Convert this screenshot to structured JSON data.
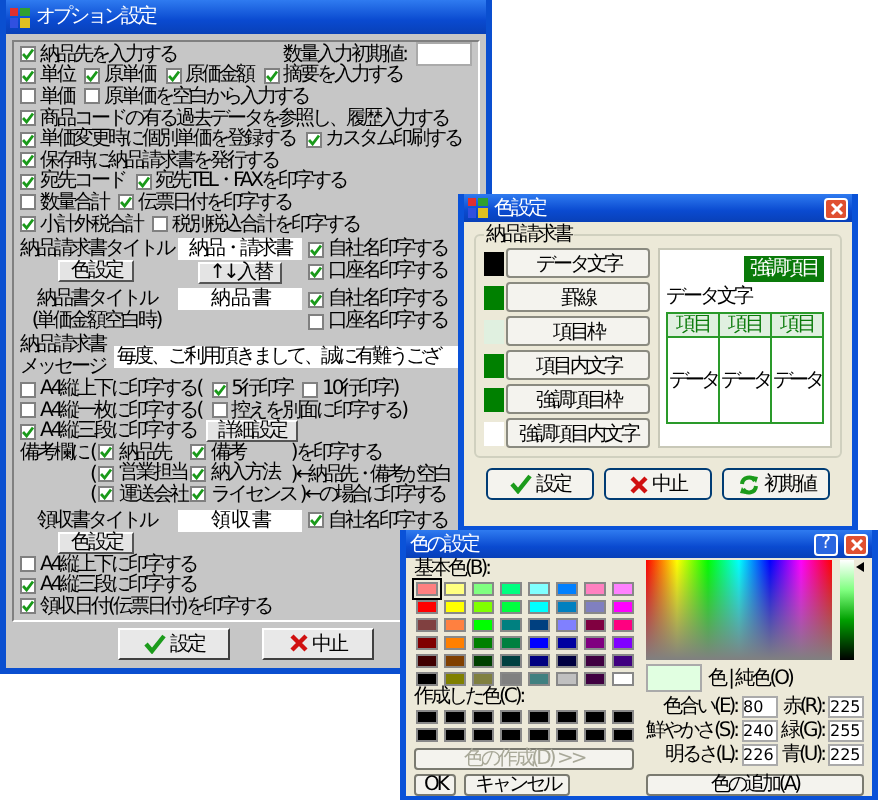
{
  "main_dialog": {
    "title": "オプション設定",
    "rows": [
      {
        "kind": "line",
        "items": [
          {
            "kind": "checkbox",
            "label": "納品先を入力する",
            "checked": true
          },
          {
            "kind": "text",
            "text": "数量入力初期値:"
          },
          {
            "kind": "field"
          }
        ]
      },
      {
        "kind": "line",
        "items": [
          {
            "kind": "checkbox",
            "label": "単位",
            "checked": true
          },
          {
            "kind": "checkbox",
            "label": "原単価",
            "checked": true
          },
          {
            "kind": "checkbox",
            "label": "原価金額",
            "checked": true
          },
          {
            "kind": "checkbox",
            "label": "摘要を入力する",
            "checked": true
          }
        ]
      },
      {
        "kind": "line",
        "items": [
          {
            "kind": "checkbox",
            "label": "単価",
            "checked": false
          },
          {
            "kind": "checkbox",
            "label": "原単価を空白から入力する",
            "checked": false
          }
        ]
      },
      {
        "kind": "line",
        "items": [
          {
            "kind": "checkbox",
            "label": "商品コードの有る過去データを参照し、履歴入力する",
            "checked": true
          }
        ]
      },
      {
        "kind": "line",
        "items": [
          {
            "kind": "checkbox",
            "label": "単価変更時に個別単価を登録する",
            "checked": true
          },
          {
            "kind": "checkbox",
            "label": "カスタム印刷する",
            "checked": true
          }
        ]
      },
      {
        "kind": "line",
        "items": [
          {
            "kind": "checkbox",
            "label": "保存時に納品請求書を発行する",
            "checked": true
          }
        ]
      },
      {
        "kind": "line",
        "items": [
          {
            "kind": "checkbox",
            "label": "宛先コード",
            "checked": true
          },
          {
            "kind": "checkbox",
            "label": "宛先TEL・FAXを印字する",
            "checked": true
          }
        ]
      },
      {
        "kind": "line",
        "items": [
          {
            "kind": "checkbox",
            "label": "数量合計",
            "checked": false
          },
          {
            "kind": "checkbox",
            "label": "伝票日付を印字する",
            "checked": true
          }
        ]
      },
      {
        "kind": "line",
        "items": [
          {
            "kind": "checkbox",
            "label": "小計外税合計",
            "checked": true
          },
          {
            "kind": "checkbox",
            "label": "税別税込合計を印字する",
            "checked": false
          }
        ]
      },
      {
        "kind": "title",
        "label": "納品請求書タイトル",
        "value": "納品・請求書",
        "label_button": "色設定",
        "field_button": "↑↓入替",
        "checks": [
          {
            "label": "自社名印字する",
            "checked": true
          },
          {
            "label": "口座名印字する",
            "checked": true
          }
        ]
      },
      {
        "kind": "title",
        "label": "納品書タイトル",
        "sublabel": "(単価金額空白時)",
        "value": "納 品 書",
        "checks": [
          {
            "label": "自社名印字する",
            "checked": true
          },
          {
            "label": "口座名印字する",
            "checked": false
          }
        ]
      },
      {
        "kind": "message",
        "label": "納品請求書",
        "sublabel": "メッセージ",
        "value": "毎度、ご利用頂きまして、誠に有難うござ"
      },
      {
        "kind": "line",
        "items": [
          {
            "kind": "checkbox",
            "label": "A4縦上下に印字する(",
            "checked": false
          },
          {
            "kind": "checkbox",
            "label": "5行印字",
            "checked": true
          },
          {
            "kind": "checkbox",
            "label": "10行印字)",
            "checked": false
          }
        ]
      },
      {
        "kind": "line",
        "items": [
          {
            "kind": "checkbox",
            "label": "A4縦一枚に印字する(",
            "checked": false
          },
          {
            "kind": "checkbox",
            "label": "控えを別面に印字する)",
            "checked": false
          }
        ]
      },
      {
        "kind": "line",
        "items": [
          {
            "kind": "checkbox",
            "label": "A4縦三段に印字する",
            "checked": true
          },
          {
            "kind": "button",
            "label": "詳細設定"
          }
        ]
      },
      {
        "kind": "remarks",
        "lead": "備考欄に",
        "rows": [
          {
            "open": "(",
            "checks": [
              {
                "label": "納品先",
                "checked": true
              },
              {
                "label": "備考",
                "checked": true
              }
            ],
            "close": ")を印字する"
          },
          {
            "open": "(",
            "checks": [
              {
                "label": "営業担当",
                "checked": true
              },
              {
                "label": "納入方法",
                "checked": true
              }
            ],
            "close": ")",
            "note": "←納品先・備考が空白"
          },
          {
            "open": "(",
            "checks": [
              {
                "label": "運送会社",
                "checked": true
              },
              {
                "label": "ライセンス",
                "checked": true
              }
            ],
            "close": ")",
            "note": "← の場合に印字する"
          }
        ]
      },
      {
        "kind": "title",
        "label": "領収書タイトル",
        "value": "領 収 書",
        "label_button": "色設定",
        "checks": [
          {
            "label": "自社名印字する",
            "checked": true
          }
        ]
      },
      {
        "kind": "line",
        "items": [
          {
            "kind": "checkbox",
            "label": "A4縦上下に印字する",
            "checked": false
          }
        ]
      },
      {
        "kind": "line",
        "items": [
          {
            "kind": "checkbox",
            "label": "A4縦三段に印字する",
            "checked": true
          }
        ]
      },
      {
        "kind": "line",
        "items": [
          {
            "kind": "checkbox",
            "label": "領収日付(伝票日付)を印字する",
            "checked": true
          }
        ]
      }
    ],
    "buttons": [
      {
        "kind": "ok",
        "label": "設定"
      },
      {
        "kind": "cancel",
        "label": "中止"
      }
    ]
  },
  "color_dialog": {
    "title": "色設定",
    "group": "納品請求書",
    "items": [
      {
        "label": "データ文字",
        "color": "#000000"
      },
      {
        "label": "罫線",
        "color": "#008000"
      },
      {
        "label": "項目枠",
        "color": "#e0f0e0"
      },
      {
        "label": "項目内文字",
        "color": "#008000"
      },
      {
        "label": "強調項目枠",
        "color": "#008000"
      },
      {
        "label": "強調項目内文字",
        "color": "#ffffff"
      }
    ],
    "preview": {
      "badge": "強調項目",
      "text": "データ文字",
      "headers": [
        "項目",
        "項目",
        "項目"
      ],
      "cells": [
        "データ",
        "データ",
        "データ"
      ]
    },
    "buttons": [
      {
        "kind": "ok",
        "label": "設定"
      },
      {
        "kind": "cancel",
        "label": "中止"
      },
      {
        "kind": "reset",
        "label": "初期値"
      }
    ]
  },
  "color_picker": {
    "title": "色の設定",
    "help": "?",
    "basic_label": "基本色(B):",
    "basic_colors": [
      {
        "color": "#ff8080",
        "selected": true
      },
      {
        "color": "#ffff80",
        "selected": false
      },
      {
        "color": "#80ff80",
        "selected": false
      },
      {
        "color": "#00ff80",
        "selected": false
      },
      {
        "color": "#80ffff",
        "selected": false
      },
      {
        "color": "#0080ff",
        "selected": false
      },
      {
        "color": "#ff80c0",
        "selected": false
      },
      {
        "color": "#ff80ff",
        "selected": false
      },
      {
        "color": "#ff0000",
        "selected": false
      },
      {
        "color": "#ffff00",
        "selected": false
      },
      {
        "color": "#80ff00",
        "selected": false
      },
      {
        "color": "#00ff40",
        "selected": false
      },
      {
        "color": "#00ffff",
        "selected": false
      },
      {
        "color": "#0080c0",
        "selected": false
      },
      {
        "color": "#8080c0",
        "selected": false
      },
      {
        "color": "#ff00ff",
        "selected": false
      },
      {
        "color": "#804040",
        "selected": false
      },
      {
        "color": "#ff8040",
        "selected": false
      },
      {
        "color": "#00ff00",
        "selected": false
      },
      {
        "color": "#008080",
        "selected": false
      },
      {
        "color": "#004080",
        "selected": false
      },
      {
        "color": "#8080ff",
        "selected": false
      },
      {
        "color": "#800040",
        "selected": false
      },
      {
        "color": "#ff0080",
        "selected": false
      },
      {
        "color": "#800000",
        "selected": false
      },
      {
        "color": "#ff8000",
        "selected": false
      },
      {
        "color": "#008000",
        "selected": false
      },
      {
        "color": "#008040",
        "selected": false
      },
      {
        "color": "#0000ff",
        "selected": false
      },
      {
        "color": "#0000a0",
        "selected": false
      },
      {
        "color": "#800080",
        "selected": false
      },
      {
        "color": "#8000ff",
        "selected": false
      },
      {
        "color": "#400000",
        "selected": false
      },
      {
        "color": "#804000",
        "selected": false
      },
      {
        "color": "#004000",
        "selected": false
      },
      {
        "color": "#004040",
        "selected": false
      },
      {
        "color": "#000080",
        "selected": false
      },
      {
        "color": "#000040",
        "selected": false
      },
      {
        "color": "#400040",
        "selected": false
      },
      {
        "color": "#400080",
        "selected": false
      },
      {
        "color": "#000000",
        "selected": false
      },
      {
        "color": "#808000",
        "selected": false
      },
      {
        "color": "#808040",
        "selected": false
      },
      {
        "color": "#808080",
        "selected": false
      },
      {
        "color": "#408080",
        "selected": false
      },
      {
        "color": "#c0c0c0",
        "selected": false
      },
      {
        "color": "#400040",
        "selected": false
      },
      {
        "color": "#ffffff",
        "selected": false
      }
    ],
    "custom_label": "作成した色(C):",
    "custom_colors": [
      {
        "color": "#000000"
      },
      {
        "color": "#000000"
      },
      {
        "color": "#000000"
      },
      {
        "color": "#000000"
      },
      {
        "color": "#000000"
      },
      {
        "color": "#000000"
      },
      {
        "color": "#000000"
      },
      {
        "color": "#000000"
      },
      {
        "color": "#000000"
      },
      {
        "color": "#000000"
      },
      {
        "color": "#000000"
      },
      {
        "color": "#000000"
      },
      {
        "color": "#000000"
      },
      {
        "color": "#000000"
      },
      {
        "color": "#000000"
      },
      {
        "color": "#000000"
      }
    ],
    "define_button": {
      "label": "色の作成(D) >>",
      "disabled": true
    },
    "ok": "OK",
    "cancel": "キャンセル",
    "luminance": {
      "level": 0.94
    },
    "preview_label": "色 | 純色(O)",
    "fields": [
      {
        "label": "色合い(E):",
        "value": "80"
      },
      {
        "label": "赤(R):",
        "value": "225"
      },
      {
        "label": "鮮やかさ(S):",
        "value": "240"
      },
      {
        "label": "緑(G):",
        "value": "255"
      },
      {
        "label": "明るさ(L):",
        "value": "226"
      },
      {
        "label": "青(U):",
        "value": "225"
      }
    ],
    "add_button": "色の追加(A)"
  }
}
